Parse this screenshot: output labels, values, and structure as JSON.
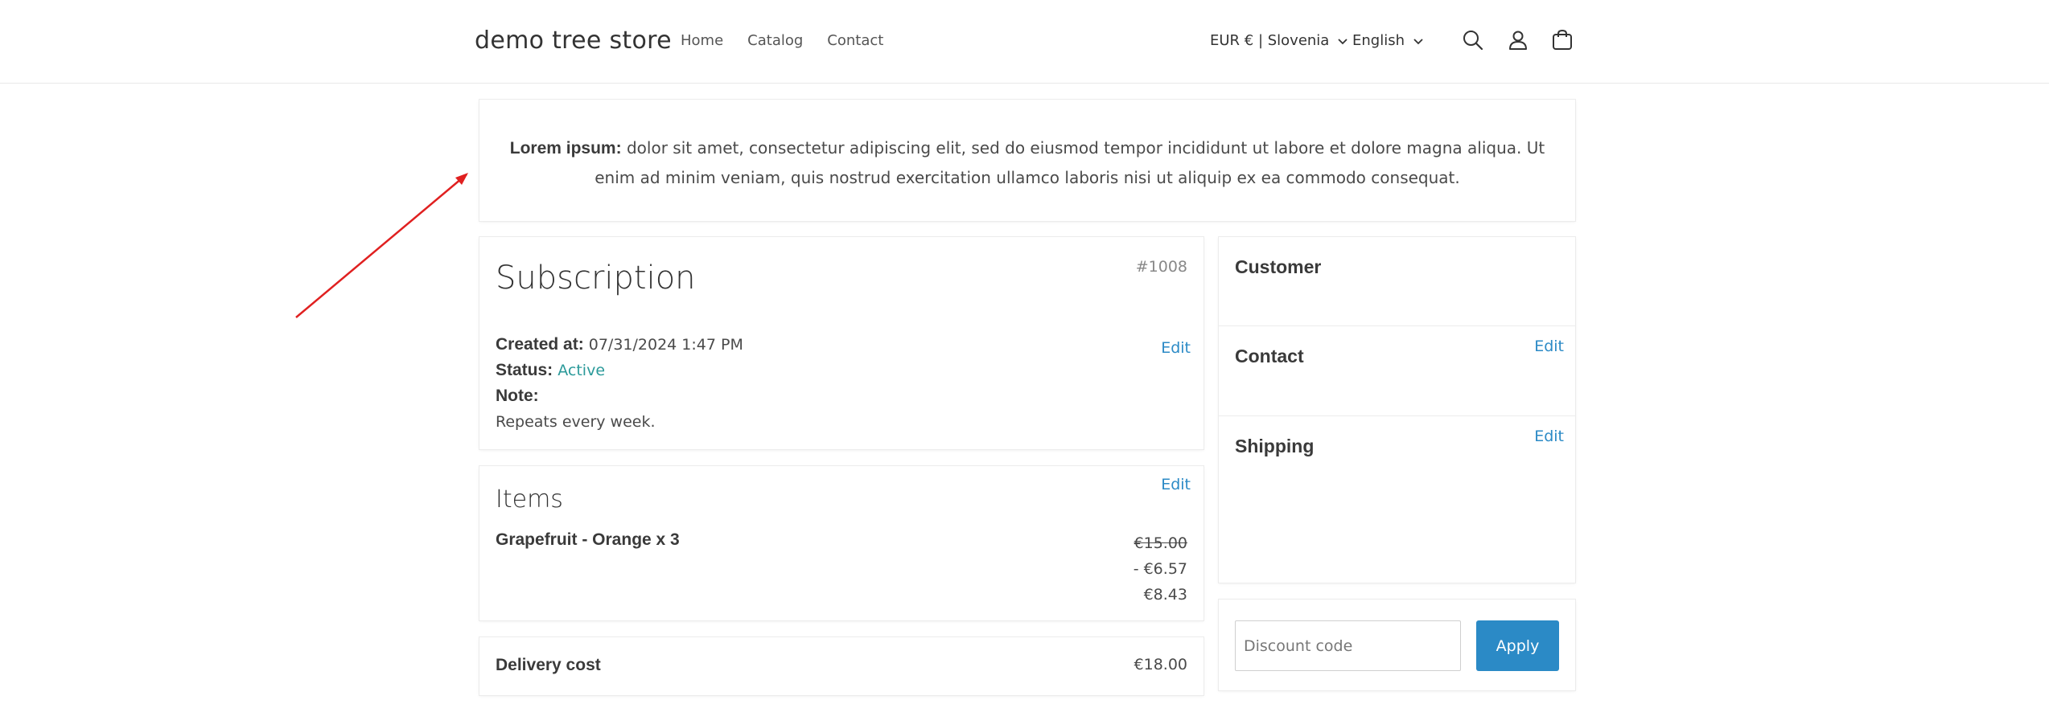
{
  "header": {
    "brand": "demo tree store",
    "nav": [
      "Home",
      "Catalog",
      "Contact"
    ],
    "currency_selector": "EUR € | Slovenia",
    "language_selector": "English",
    "icons": [
      "search-icon",
      "account-icon",
      "cart-icon"
    ]
  },
  "banner": {
    "label": "Lorem ipsum:",
    "text": "dolor sit amet, consectetur adipiscing elit, sed do eiusmod tempor incididunt ut labore et dolore magna aliqua. Ut enim ad minim veniam, quis nostrud exercitation ullamco laboris nisi ut aliquip ex ea commodo consequat."
  },
  "subscription": {
    "title": "Subscription",
    "id": "#1008",
    "edit_label": "Edit",
    "created_label": "Created at:",
    "created_value": "07/31/2024 1:47 PM",
    "status_label": "Status:",
    "status_value": "Active",
    "note_label": "Note:",
    "note_value": "Repeats every week."
  },
  "items": {
    "title": "Items",
    "edit_label": "Edit",
    "list": [
      {
        "name": "Grapefruit - Orange x 3",
        "original_price": "€15.00",
        "discount": "- €6.57",
        "final_price": "€8.43"
      }
    ]
  },
  "delivery": {
    "label": "Delivery cost",
    "value": "€18.00"
  },
  "sidebar": {
    "customer": {
      "heading": "Customer"
    },
    "contact": {
      "heading": "Contact",
      "edit_label": "Edit"
    },
    "shipping": {
      "heading": "Shipping",
      "edit_label": "Edit"
    }
  },
  "discount": {
    "placeholder": "Discount code",
    "button_label": "Apply"
  },
  "colors": {
    "accent": "#2b8ac6",
    "status_active": "#2b9a9a",
    "annotation_arrow": "#e02020"
  }
}
